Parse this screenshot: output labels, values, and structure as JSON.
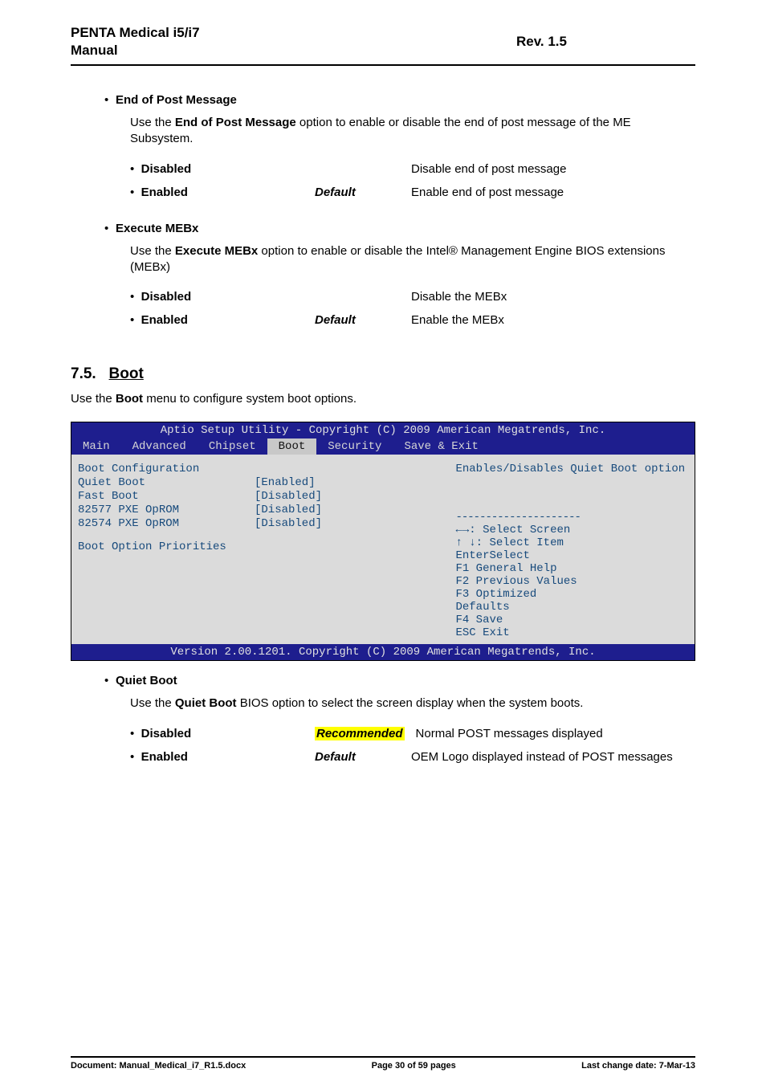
{
  "header": {
    "title_line1": "PENTA Medical i5/i7",
    "title_line2": "Manual",
    "rev": "Rev. 1.5"
  },
  "sec_eop": {
    "title": "End of Post Message",
    "para_pre": "Use the ",
    "para_bold": "End of Post Message",
    "para_post": " option to enable or disable the end of post message of the ME Subsystem.",
    "opt1": {
      "name": "Disabled",
      "tag": "",
      "desc": "Disable end of post message"
    },
    "opt2": {
      "name": "Enabled",
      "tag": "Default",
      "desc": "Enable end of post message"
    }
  },
  "sec_mebx": {
    "title": "Execute MEBx",
    "para_pre": "Use the ",
    "para_bold": "Execute MEBx",
    "para_post": " option to enable or disable the Intel® Management Engine BIOS extensions (MEBx)",
    "opt1": {
      "name": "Disabled",
      "tag": "",
      "desc": "Disable the MEBx"
    },
    "opt2": {
      "name": "Enabled",
      "tag": "Default",
      "desc": "Enable the MEBx"
    }
  },
  "heading": {
    "num": "7.5.",
    "title": "Boot"
  },
  "boot_intro_pre": "Use the ",
  "boot_intro_bold": "Boot",
  "boot_intro_post": " menu to configure system boot options.",
  "bios": {
    "top": "Aptio Setup Utility - Copyright (C) 2009 American Megatrends, Inc.",
    "tabs": [
      "Main",
      "Advanced",
      "Chipset",
      "Boot",
      "Security",
      "Save & Exit"
    ],
    "left": {
      "heading": "Boot Configuration",
      "rows": [
        {
          "label": "Quiet Boot",
          "value": "[Enabled]"
        },
        {
          "label": "Fast Boot",
          "value": "[Disabled]"
        },
        {
          "label": "82577 PXE OpROM",
          "value": "[Disabled]"
        },
        {
          "label": "82574 PXE OpROM",
          "value": "[Disabled]"
        }
      ],
      "sub": "Boot Option Priorities"
    },
    "right": {
      "help": "Enables/Disables Quiet Boot option",
      "sep": "---------------------",
      "lines": [
        "←→: Select Screen",
        "↑ ↓: Select Item",
        "EnterSelect",
        "F1   General Help",
        "F2   Previous Values",
        "F3    Optimized",
        "Defaults",
        "F4     Save",
        "ESC   Exit"
      ]
    },
    "footer": "Version 2.00.1201. Copyright (C) 2009 American Megatrends, Inc."
  },
  "sec_qb": {
    "title": "Quiet Boot",
    "para_pre": "Use the ",
    "para_bold": "Quiet Boot",
    "para_post": " BIOS option to select the screen display when the system boots.",
    "opt1": {
      "name": "Disabled",
      "tag": "Recommended",
      "desc": "Normal POST messages displayed"
    },
    "opt2": {
      "name": "Enabled",
      "tag": "Default",
      "desc": "OEM Logo displayed instead of POST messages"
    }
  },
  "footer": {
    "doc": "Document: Manual_Medical_i7_R1.5.docx",
    "page": "Page 30 of 59 pages",
    "date": "Last change date: 7-Mar-13"
  }
}
